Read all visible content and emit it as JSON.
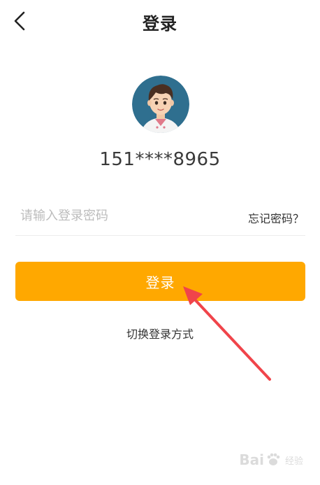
{
  "header": {
    "title": "登录",
    "back_icon": "chevron-left-icon"
  },
  "profile": {
    "avatar_icon": "user-avatar",
    "phone": "151****8965"
  },
  "password": {
    "placeholder": "请输入登录密码",
    "value": "",
    "forgot_label": "忘记密码？"
  },
  "actions": {
    "login_label": "登录",
    "switch_label": "切换登录方式"
  },
  "colors": {
    "accent": "#ffa800",
    "annotation_arrow": "#f0444a"
  },
  "watermark": {
    "brand_left": "Bai",
    "brand_right": "经验",
    "url": "jingyan.baidu.com"
  }
}
